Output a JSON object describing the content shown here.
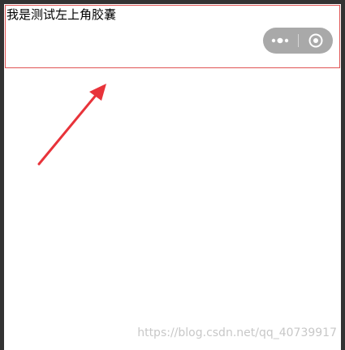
{
  "header": {
    "title": "我是测试左上角胶囊"
  },
  "capsule": {
    "menu_icon": "more-dots-icon",
    "close_icon": "target-circle-icon",
    "color": "#a9a9a9"
  },
  "annotation": {
    "arrow_color": "#e8333a"
  },
  "watermark": {
    "text": "https://blog.csdn.net/qq_40739917"
  }
}
